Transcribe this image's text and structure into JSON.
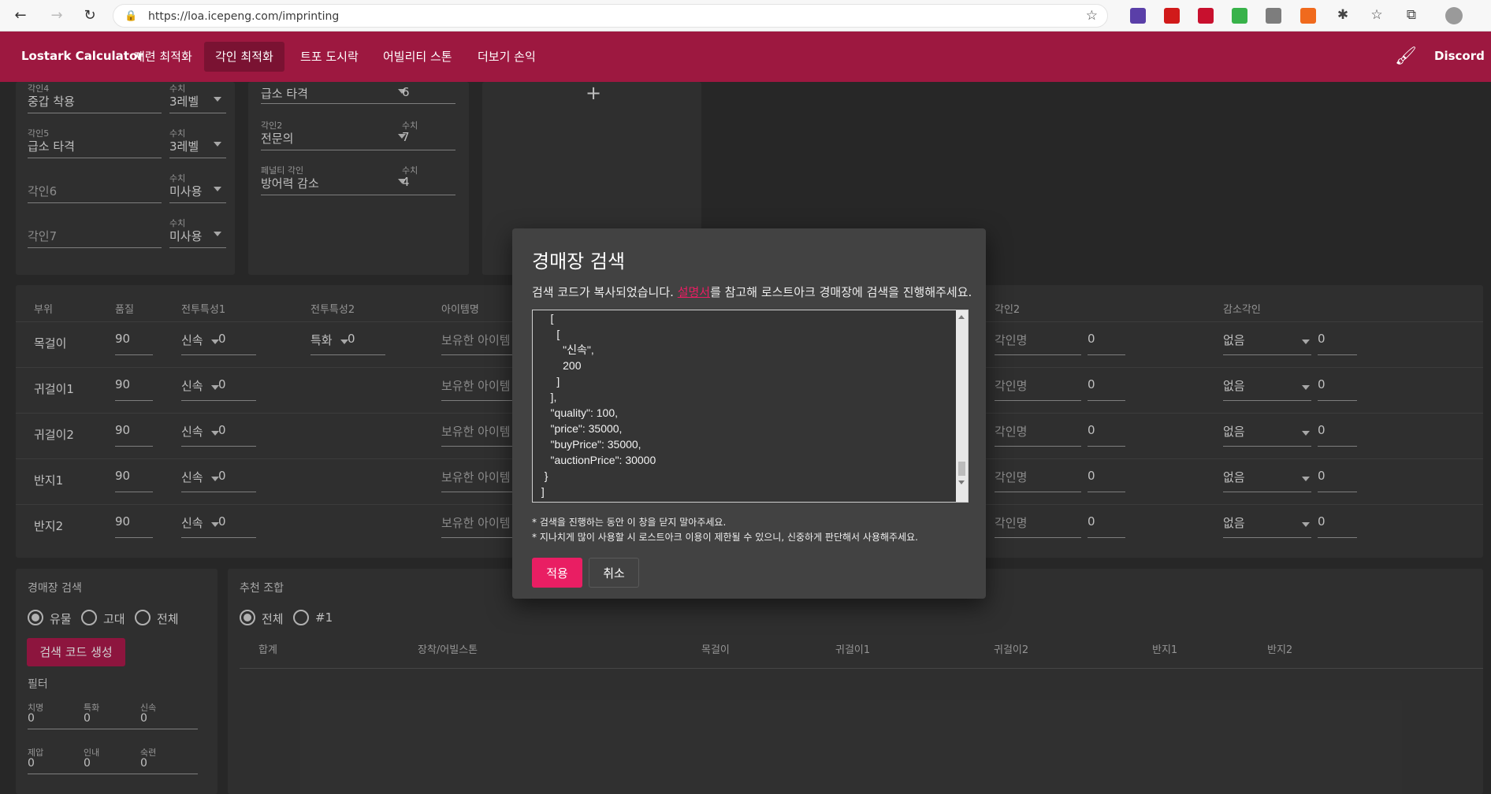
{
  "browser": {
    "url": "https://loa.icepeng.com/imprinting"
  },
  "appbar": {
    "brand": "Lostark Calculator",
    "tabs": [
      "재련 최적화",
      "각인 최적화",
      "트포 도시락",
      "어빌리티 스톤",
      "더보기 손익"
    ],
    "discord": "Discord"
  },
  "left_card": {
    "value_label": "수치",
    "rows": [
      {
        "label": "각인4",
        "name": "중갑 착용",
        "value": "3레벨"
      },
      {
        "label": "각인5",
        "name": "급소 타격",
        "value": "3레벨"
      },
      {
        "label": "각인6",
        "name": "",
        "value": "미사용"
      },
      {
        "label": "각인7",
        "name": "",
        "value": "미사용"
      }
    ]
  },
  "mid_card": {
    "value_label": "수치",
    "rows": [
      {
        "label": "",
        "name": "급소 타격",
        "value": "6"
      },
      {
        "label": "각인2",
        "name": "전문의",
        "value": "7"
      },
      {
        "label": "페널티 각인",
        "name": "방어력 감소",
        "value": "4"
      }
    ]
  },
  "table": {
    "headers": [
      "부위",
      "품질",
      "전투특성1",
      "전투특성2",
      "아이템명",
      "각인2",
      "감소각인"
    ],
    "placeholders": {
      "item": "보유한 아이템",
      "engraving": "각인명"
    },
    "rows": [
      {
        "part": "목걸이",
        "quality": "90",
        "stat1": "신속",
        "stat1v": "0",
        "stat2": "특화",
        "stat2v": "0",
        "eng2v": "0",
        "neg": "없음",
        "negv": "0"
      },
      {
        "part": "귀걸이1",
        "quality": "90",
        "stat1": "신속",
        "stat1v": "0",
        "eng2v": "0",
        "neg": "없음",
        "negv": "0"
      },
      {
        "part": "귀걸이2",
        "quality": "90",
        "stat1": "신속",
        "stat1v": "0",
        "eng2v": "0",
        "neg": "없음",
        "negv": "0"
      },
      {
        "part": "반지1",
        "quality": "90",
        "stat1": "신속",
        "stat1v": "0",
        "eng2v": "0",
        "neg": "없음",
        "negv": "0"
      },
      {
        "part": "반지2",
        "quality": "90",
        "stat1": "신속",
        "stat1v": "0",
        "eng2v": "0",
        "neg": "없음",
        "negv": "0"
      }
    ]
  },
  "auction": {
    "title": "경매장 검색",
    "options": [
      "유물",
      "고대",
      "전체"
    ],
    "button": "검색 코드 생성",
    "filter_title": "필터",
    "filters": [
      {
        "label": "치명",
        "value": "0"
      },
      {
        "label": "특화",
        "value": "0"
      },
      {
        "label": "신속",
        "value": "0"
      },
      {
        "label": "제압",
        "value": "0"
      },
      {
        "label": "인내",
        "value": "0"
      },
      {
        "label": "숙련",
        "value": "0"
      }
    ]
  },
  "recommend": {
    "title": "추천 조합",
    "options": [
      "전체",
      "#1"
    ],
    "headers": [
      "합계",
      "장착/어빌스톤",
      "목걸이",
      "귀걸이1",
      "귀걸이2",
      "반지1",
      "반지2"
    ]
  },
  "dialog": {
    "title": "경매장 검색",
    "desc_before": "검색 코드가 복사되었습니다. ",
    "desc_link": "설명서",
    "desc_after": "를 참고해 로스트아크 경매장에 검색을 진행해주세요.",
    "code": "    [\n      [\n        \"신속\",\n        200\n      ]\n    ],\n    \"quality\": 100,\n    \"price\": 35000,\n    \"buyPrice\": 35000,\n    \"auctionPrice\": 30000\n  }\n ]\n}",
    "note1": "* 검색을 진행하는 동안 이 창을 닫지 말아주세요.",
    "note2": "* 지나치게 많이 사용할 시 로스트아크 이용이 제한될 수 있으니, 신중하게 판단해서 사용해주세요.",
    "apply": "적용",
    "cancel": "취소"
  }
}
